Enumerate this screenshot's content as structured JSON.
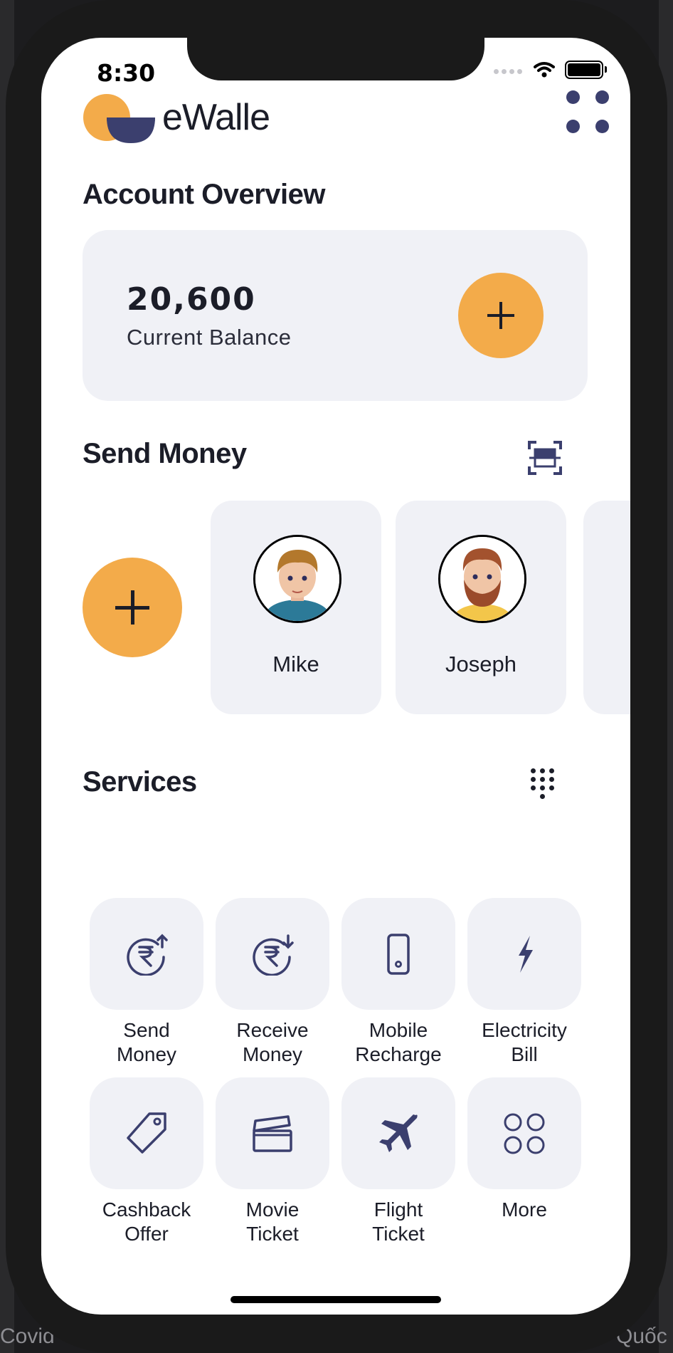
{
  "status_bar": {
    "time": "8:30"
  },
  "app": {
    "brand": "eWalle"
  },
  "account_overview": {
    "title": "Account Overview",
    "balance": "20,600",
    "balance_label": "Current Balance"
  },
  "send_money": {
    "title": "Send Money",
    "contacts": [
      {
        "name": "Mike"
      },
      {
        "name": "Joseph"
      }
    ]
  },
  "services": {
    "title": "Services",
    "items": [
      {
        "line1": "Send",
        "line2": "Money",
        "icon": "send-money-icon"
      },
      {
        "line1": "Receive",
        "line2": "Money",
        "icon": "receive-money-icon"
      },
      {
        "line1": "Mobile",
        "line2": "Recharge",
        "icon": "mobile-icon"
      },
      {
        "line1": "Electricity",
        "line2": "Bill",
        "icon": "lightning-icon"
      },
      {
        "line1": "Cashback",
        "line2": "Offer",
        "icon": "tag-icon"
      },
      {
        "line1": "Movie",
        "line2": "Ticket",
        "icon": "ticket-icon"
      },
      {
        "line1": "Flight",
        "line2": "Ticket",
        "icon": "airplane-icon"
      },
      {
        "line1": "More",
        "line2": "",
        "icon": "grid-icon"
      }
    ]
  },
  "background": {
    "text_left": "Covid",
    "text_right": "Quốc"
  },
  "colors": {
    "accent": "#F3AB4A",
    "navy": "#3B3F6E",
    "card": "#F0F1F6",
    "text": "#1B1D28"
  }
}
